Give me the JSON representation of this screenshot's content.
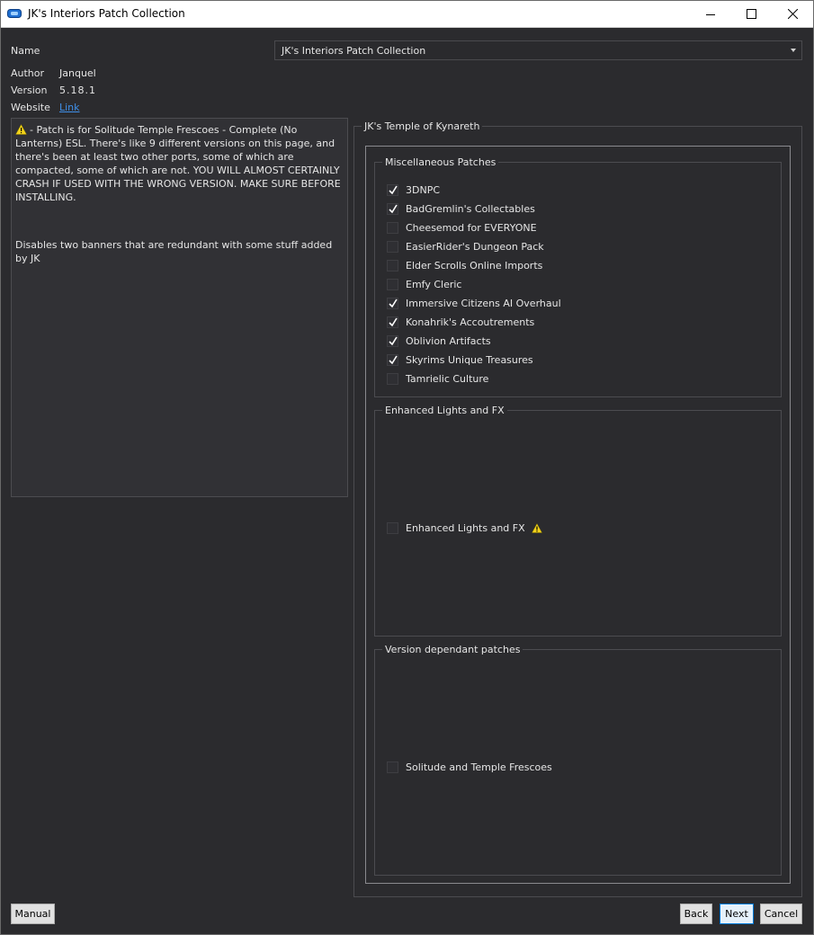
{
  "window": {
    "title": "JK's Interiors Patch Collection"
  },
  "info": {
    "name_label": "Name",
    "name_value": "JK's Interiors Patch Collection",
    "author_label": "Author",
    "author_value": "Janquel",
    "version_label": "Version",
    "version_value": "5.18.1",
    "website_label": "Website",
    "website_link": "Link"
  },
  "description": {
    "paragraph1": "- Patch is for Solitude Temple Frescoes - Complete (No Lanterns) ESL. There's like 9 different versions on this page, and there's been at least two other ports, some of which are compacted, some of which are not. YOU WILL ALMOST CERTAINLY CRASH IF USED WITH THE WRONG VERSION. MAKE SURE BEFORE INSTALLING.",
    "paragraph2": "Disables two banners that are redundant with some stuff added by JK"
  },
  "step": {
    "title": "JK's Temple of Kynareth",
    "groups": [
      {
        "title": "Miscellaneous Patches",
        "options": [
          {
            "label": "3DNPC",
            "checked": true
          },
          {
            "label": "BadGremlin's Collectables",
            "checked": true
          },
          {
            "label": "Cheesemod for EVERYONE",
            "checked": false
          },
          {
            "label": "EasierRider's Dungeon Pack",
            "checked": false
          },
          {
            "label": "Elder Scrolls Online Imports",
            "checked": false
          },
          {
            "label": "Emfy Cleric",
            "checked": false
          },
          {
            "label": "Immersive Citizens AI Overhaul",
            "checked": true
          },
          {
            "label": "Konahrik's Accoutrements",
            "checked": true
          },
          {
            "label": "Oblivion Artifacts",
            "checked": true
          },
          {
            "label": "Skyrims Unique Treasures",
            "checked": true
          },
          {
            "label": "Tamrielic Culture",
            "checked": false
          }
        ]
      },
      {
        "title": "Enhanced Lights and FX",
        "options": [
          {
            "label": "Enhanced Lights and FX",
            "checked": false,
            "warning": true
          }
        ]
      },
      {
        "title": "Version dependant patches",
        "options": [
          {
            "label": "Solitude and Temple Frescoes",
            "checked": false
          }
        ]
      }
    ]
  },
  "buttons": {
    "manual": "Manual",
    "back": "Back",
    "next": "Next",
    "cancel": "Cancel"
  },
  "colors": {
    "background": "#2b2b2e",
    "link": "#3f8fe8",
    "warning": "#f2d21b"
  }
}
